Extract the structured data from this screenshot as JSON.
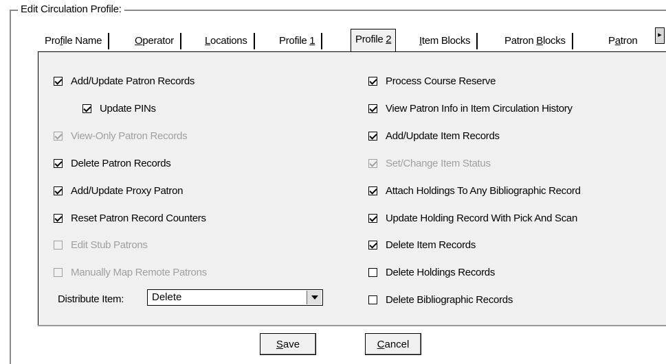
{
  "group": {
    "title": "Edit Circulation Profile:"
  },
  "tabs": [
    {
      "pre": "Pro",
      "ul": "f",
      "post": "ile Name",
      "active": false
    },
    {
      "pre": "",
      "ul": "O",
      "post": "perator",
      "active": false
    },
    {
      "pre": "",
      "ul": "L",
      "post": "ocations",
      "active": false
    },
    {
      "pre": "Profile ",
      "ul": "1",
      "post": "",
      "active": false
    },
    {
      "pre": "Profile ",
      "ul": "2",
      "post": "",
      "active": true
    },
    {
      "pre": "",
      "ul": "I",
      "post": "tem Blocks",
      "active": false
    },
    {
      "pre": "Patron ",
      "ul": "B",
      "post": "locks",
      "active": false
    },
    {
      "pre": "P",
      "ul": "a",
      "post": "tron",
      "active": false
    }
  ],
  "tab_scroll_icon": "arrow-right-icon",
  "left_checkboxes": [
    {
      "label": "Add/Update Patron Records",
      "checked": true,
      "enabled": true
    },
    {
      "label": "Update PINs",
      "checked": true,
      "enabled": true
    },
    {
      "label": "View-Only Patron Records",
      "checked": true,
      "enabled": false
    },
    {
      "label": "Delete Patron Records",
      "checked": true,
      "enabled": true
    },
    {
      "label": "Add/Update Proxy Patron",
      "checked": true,
      "enabled": true
    },
    {
      "label": "Reset Patron Record Counters",
      "checked": true,
      "enabled": true
    },
    {
      "label": "Edit Stub Patrons",
      "checked": false,
      "enabled": false
    },
    {
      "label": "Manually Map Remote Patrons",
      "checked": false,
      "enabled": false
    }
  ],
  "right_checkboxes": [
    {
      "label": "Process Course Reserve",
      "checked": true,
      "enabled": true
    },
    {
      "label": "View Patron Info in Item Circulation History",
      "checked": true,
      "enabled": true
    },
    {
      "label": "Add/Update Item Records",
      "checked": true,
      "enabled": true
    },
    {
      "label": "Set/Change Item Status",
      "checked": true,
      "enabled": false
    },
    {
      "label": "Attach Holdings To Any Bibliographic Record",
      "checked": true,
      "enabled": true
    },
    {
      "label": "Update Holding Record With Pick And Scan",
      "checked": true,
      "enabled": true
    },
    {
      "label": "Delete Item Records",
      "checked": true,
      "enabled": true
    },
    {
      "label": "Delete Holdings Records",
      "checked": false,
      "enabled": true
    },
    {
      "label": "Delete Bibliographic Records",
      "checked": false,
      "enabled": true
    }
  ],
  "distribute": {
    "label": "Distribute Item:",
    "value": "Delete"
  },
  "buttons": {
    "save": {
      "ul": "S",
      "rest": "ave"
    },
    "cancel": {
      "ul": "C",
      "rest": "ancel"
    }
  }
}
